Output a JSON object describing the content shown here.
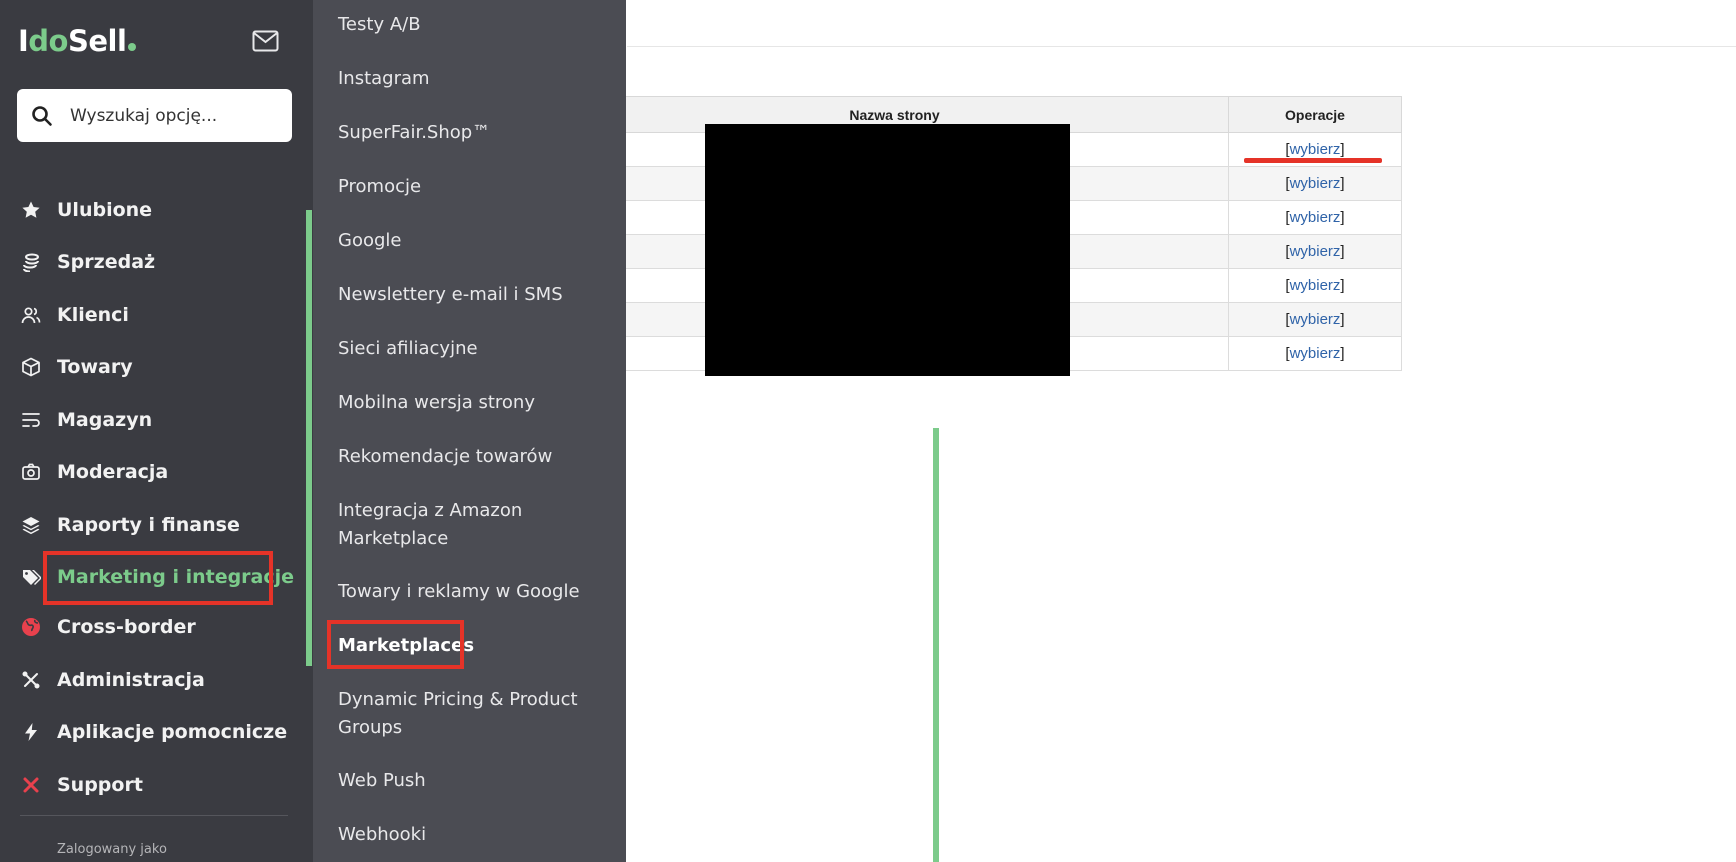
{
  "brand": {
    "logo_prefix": "I",
    "logo_highlight": "do",
    "logo_suffix": "Sell"
  },
  "search": {
    "placeholder": "Wyszukaj opcję..."
  },
  "sidebar": {
    "items": [
      {
        "label": "Ulubione",
        "icon": "star-icon"
      },
      {
        "label": "Sprzedaż",
        "icon": "coins-icon"
      },
      {
        "label": "Klienci",
        "icon": "users-icon"
      },
      {
        "label": "Towary",
        "icon": "box-icon"
      },
      {
        "label": "Magazyn",
        "icon": "warehouse-icon"
      },
      {
        "label": "Moderacja",
        "icon": "camera-icon"
      },
      {
        "label": "Raporty i finanse",
        "icon": "layers-icon"
      },
      {
        "label": "Marketing i integracje",
        "icon": "tags-icon",
        "active": true
      },
      {
        "label": "Cross-border",
        "icon": "globe-icon"
      },
      {
        "label": "Administracja",
        "icon": "tools-icon"
      },
      {
        "label": "Aplikacje pomocnicze",
        "icon": "bolt-icon"
      },
      {
        "label": "Support",
        "icon": "support-icon"
      }
    ],
    "footer_label": "Zalogowany jako"
  },
  "submenu": {
    "items": [
      {
        "label": "Testy A/B"
      },
      {
        "label": "Instagram"
      },
      {
        "label": "SuperFair.Shop™"
      },
      {
        "label": "Promocje"
      },
      {
        "label": "Google"
      },
      {
        "label": "Newslettery e-mail i SMS"
      },
      {
        "label": "Sieci afiliacyjne"
      },
      {
        "label": "Mobilna wersja strony"
      },
      {
        "label": "Rekomendacje towarów"
      },
      {
        "label": "Integracja z Amazon Marketplace"
      },
      {
        "label": "Towary i reklamy w Google"
      },
      {
        "label": "Marketplaces",
        "highlighted": true
      },
      {
        "label": "Dynamic Pricing & Product Groups"
      },
      {
        "label": "Web Push"
      },
      {
        "label": "Webhooki"
      }
    ]
  },
  "table": {
    "headers": {
      "name": "Nazwa strony",
      "operations": "Operacje"
    },
    "bracket_open": "[",
    "bracket_close": "]",
    "rows": [
      {
        "action": "wybierz"
      },
      {
        "action": "wybierz"
      },
      {
        "action": "wybierz"
      },
      {
        "action": "wybierz"
      },
      {
        "action": "wybierz"
      },
      {
        "action": "wybierz"
      },
      {
        "action": "wybierz"
      }
    ]
  },
  "colors": {
    "sidebar_bg": "#3a3b41",
    "submenu_bg": "#4b4c53",
    "accent_green": "#7ccb8b",
    "annotation_red": "#e53328",
    "link_blue": "#2f63a8"
  }
}
